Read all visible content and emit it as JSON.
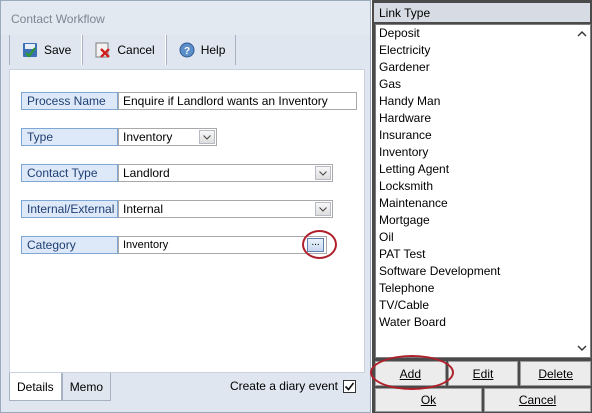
{
  "contact_workflow": {
    "title": "Contact Workflow",
    "toolbar": {
      "save_label": "Save",
      "cancel_label": "Cancel",
      "help_label": "Help"
    },
    "fields": {
      "process_name": {
        "label": "Process Name",
        "value": "Enquire if Landlord wants an Inventory"
      },
      "type": {
        "label": "Type",
        "value": "Inventory"
      },
      "contact_type": {
        "label": "Contact Type",
        "value": "Landlord"
      },
      "internal_external": {
        "label": "Internal/External",
        "value": "Internal"
      },
      "category": {
        "label": "Category",
        "value": "Inventory",
        "button": "..."
      }
    },
    "tabs": [
      {
        "label": "Details",
        "active": true
      },
      {
        "label": "Memo",
        "active": false
      }
    ],
    "diary_event": {
      "label": "Create a diary event",
      "checked": true
    }
  },
  "link_type": {
    "title": "Link Type",
    "items": [
      "Deposit",
      "Electricity",
      "Gardener",
      "Gas",
      "Handy Man",
      "Hardware",
      "Insurance",
      "Inventory",
      "Letting Agent",
      "Locksmith",
      "Maintenance",
      "Mortgage",
      "Oil",
      "PAT Test",
      "Software Development",
      "Telephone",
      "TV/Cable",
      "Water Board"
    ],
    "buttons": {
      "add": "Add",
      "edit": "Edit",
      "delete": "Delete",
      "ok": "Ok",
      "cancel": "Cancel"
    }
  },
  "colors": {
    "highlight_circle": "#b0202a",
    "field_label_bg": "#dde8f8",
    "field_label_border": "#7fa7d6"
  },
  "icons": [
    "save-icon",
    "cancel-icon",
    "help-icon",
    "chevron-down-icon",
    "scroll-up-icon",
    "scroll-down-icon",
    "checkmark-icon"
  ]
}
